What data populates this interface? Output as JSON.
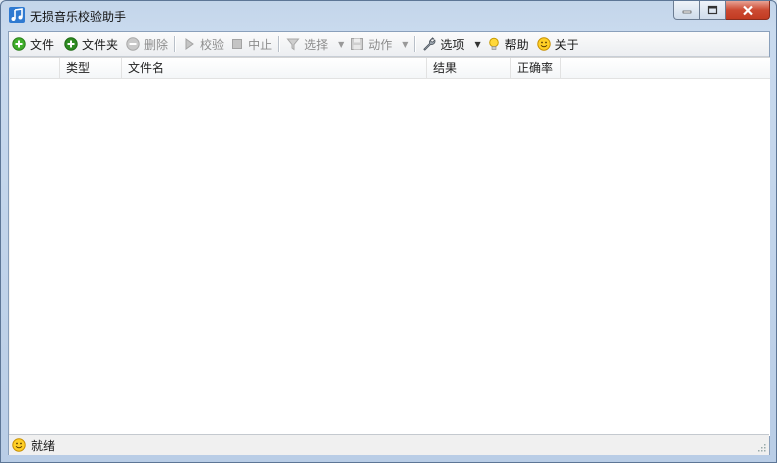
{
  "window": {
    "title": "无损音乐校验助手"
  },
  "toolbar": {
    "add_file": "文件",
    "add_folder": "文件夹",
    "delete": "删除",
    "verify": "校验",
    "stop": "中止",
    "select": "选择",
    "action": "动作",
    "options": "选项",
    "help": "帮助",
    "about": "关于"
  },
  "table": {
    "columns": [
      "",
      "类型",
      "文件名",
      "结果",
      "正确率"
    ],
    "rows": []
  },
  "status": {
    "text": "就绪"
  }
}
